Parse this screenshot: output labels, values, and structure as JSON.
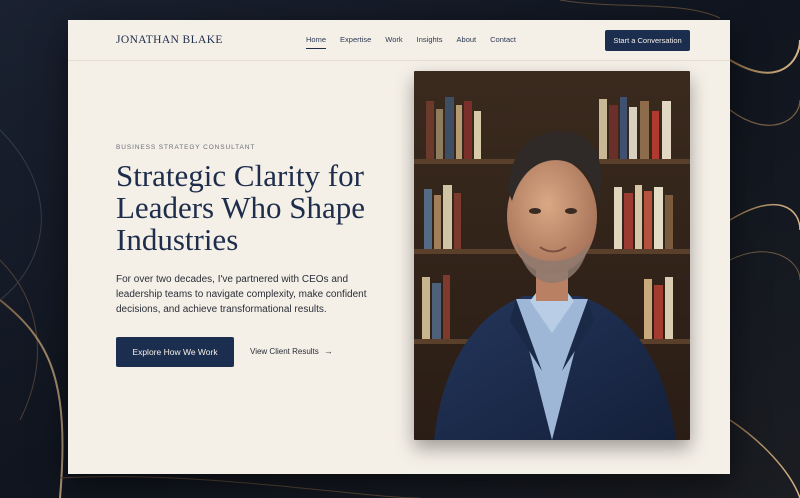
{
  "header": {
    "brand": "JONATHAN BLAKE",
    "nav": [
      {
        "label": "Home",
        "active": true
      },
      {
        "label": "Expertise"
      },
      {
        "label": "Work"
      },
      {
        "label": "Insights"
      },
      {
        "label": "About"
      },
      {
        "label": "Contact"
      }
    ],
    "cta_label": "Start a Conversation"
  },
  "hero": {
    "eyebrow": "BUSINESS STRATEGY CONSULTANT",
    "headline": "Strategic Clarity for Leaders Who Shape Industries",
    "lead": "For over two decades, I've partnered with CEOs and leadership teams to navigate complexity, make confident decisions, and achieve transformational results.",
    "primary_cta": "Explore How We Work",
    "secondary_cta": "View Client Results",
    "secondary_icon": "arrow-right-icon"
  },
  "colors": {
    "brand_navy": "#1c2e4f",
    "card_cream": "#f4efe7",
    "background": "#0f1420",
    "accent_gold": "#b58d58"
  }
}
